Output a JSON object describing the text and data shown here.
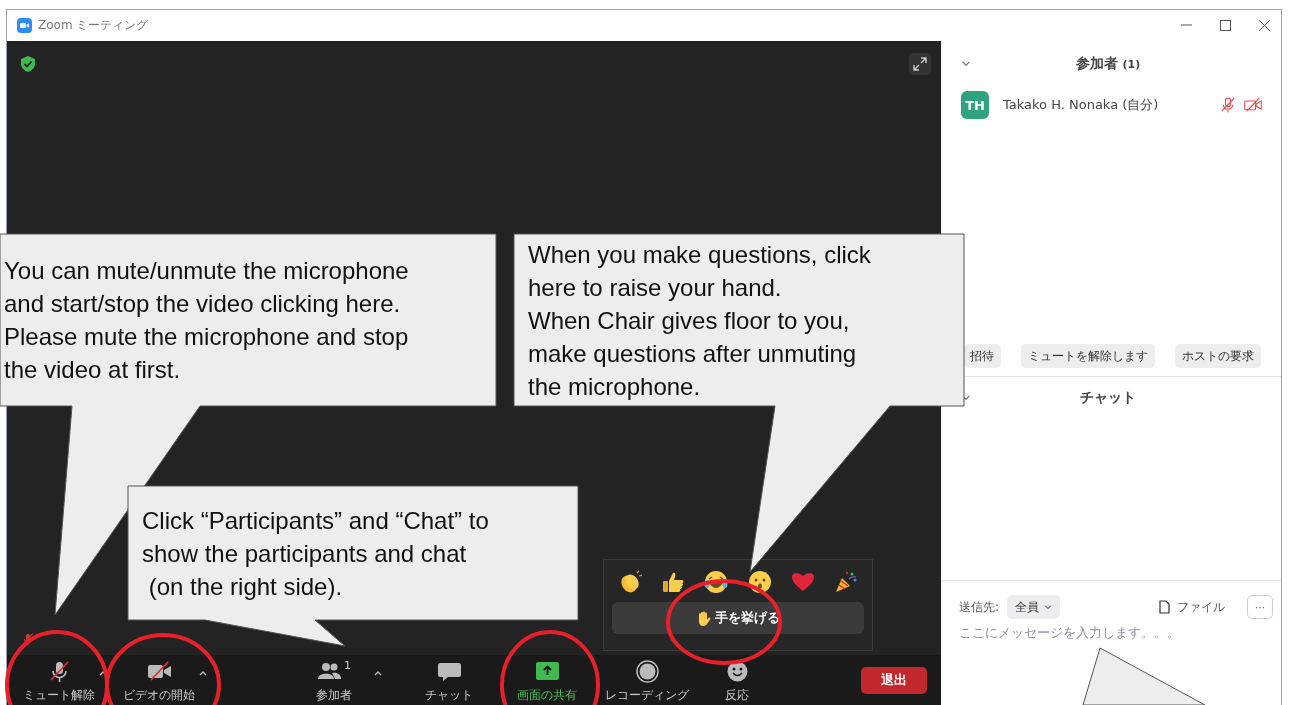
{
  "window": {
    "title": "Zoom ミーティング"
  },
  "reactions_popup": {
    "emojis": [
      {
        "kind": "clap"
      },
      {
        "kind": "thumbs_up"
      },
      {
        "kind": "laugh"
      },
      {
        "kind": "surprised"
      },
      {
        "kind": "heart"
      },
      {
        "kind": "party"
      }
    ],
    "raise_hand": "手を挙げる"
  },
  "toolbar": {
    "items": [
      {
        "kind": "mic",
        "label": "ミュート解除",
        "off": true,
        "caret": true
      },
      {
        "kind": "video",
        "label": "ビデオの開始",
        "off": true,
        "caret": true
      },
      {
        "kind": "participants",
        "label": "参加者",
        "count": "1",
        "caret": true
      },
      {
        "kind": "chat",
        "label": "チャット"
      },
      {
        "kind": "share",
        "label": "画面の共有"
      },
      {
        "kind": "record",
        "label": "レコーディング"
      },
      {
        "kind": "reactions",
        "label": "反応"
      }
    ],
    "leave": "退出"
  },
  "participants_panel": {
    "title": "参加者",
    "count": "(1)",
    "participants": [
      {
        "initials": "TH",
        "name": "Takako H. Nonaka (自分)",
        "mic_muted": true,
        "video_off": true
      }
    ],
    "buttons": [
      "招待",
      "ミュートを解除します",
      "ホストの要求"
    ]
  },
  "chat_panel": {
    "title": "チャット",
    "send_to_label": "送信先:",
    "recipient": "全員",
    "file_button": "ファイル",
    "more_button": "···",
    "placeholder": "ここにメッセージを入力します。。。"
  },
  "annotations": [
    {
      "kind": "mic_video",
      "text": "You can mute/unmute the microphone\nand start/stop the video clicking here.\nPlease mute the microphone and stop\nthe video at first."
    },
    {
      "kind": "raise_hand",
      "text": "When you make questions, click\nhere to raise your hand.\nWhen Chair gives floor to you,\nmake questions after unmuting\nthe microphone."
    },
    {
      "kind": "participants_chat",
      "text": "Click “Participants” and “Chat” to\nshow the participants and chat\n (on the right side)."
    }
  ]
}
